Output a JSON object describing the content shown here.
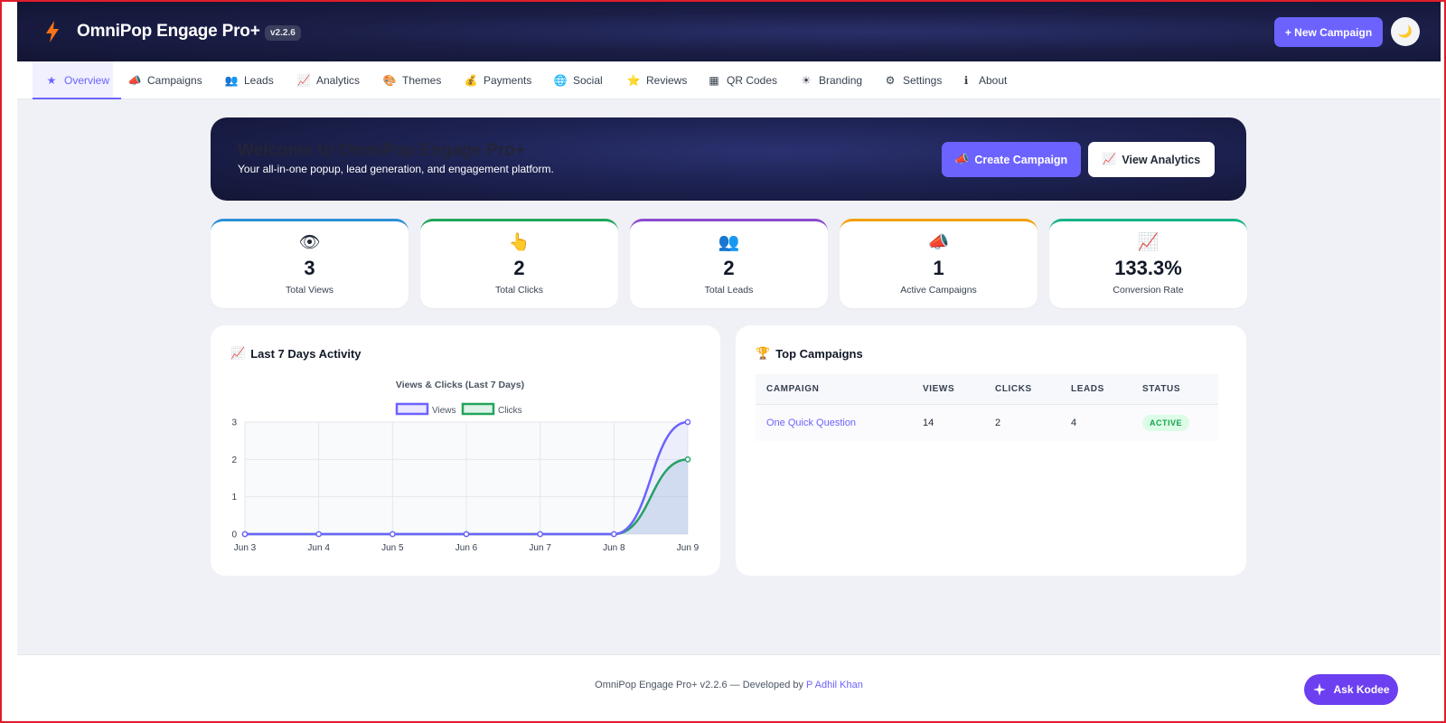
{
  "header": {
    "brand": "OmniPop Engage Pro+",
    "version": "v2.2.6",
    "new_campaign_label": "+ New Campaign",
    "theme_toggle_icon": "🌙"
  },
  "tabs": [
    {
      "icon": "★",
      "label": "Overview",
      "active": true
    },
    {
      "icon": "📣",
      "label": "Campaigns"
    },
    {
      "icon": "👥",
      "label": "Leads"
    },
    {
      "icon": "📈",
      "label": "Analytics"
    },
    {
      "icon": "🎨",
      "label": "Themes"
    },
    {
      "icon": "💰",
      "label": "Payments"
    },
    {
      "icon": "🌐",
      "label": "Social"
    },
    {
      "icon": "⭐",
      "label": "Reviews"
    },
    {
      "icon": "▦",
      "label": "QR Codes"
    },
    {
      "icon": "☀",
      "label": "Branding"
    },
    {
      "icon": "⚙",
      "label": "Settings"
    },
    {
      "icon": "ℹ",
      "label": "About"
    }
  ],
  "hero": {
    "title": "Welcome to OmniPop Engage Pro+",
    "subtitle": "Your all-in-one popup, lead generation, and engagement platform.",
    "create_label": "Create Campaign",
    "create_icon": "📣",
    "view_label": "View Analytics",
    "view_icon": "📈"
  },
  "stats": [
    {
      "icon": "👁",
      "value": "3",
      "label": "Total Views",
      "color": "#2b8fd6"
    },
    {
      "icon": "👆",
      "value": "2",
      "label": "Total Clicks",
      "color": "#22a55b"
    },
    {
      "icon": "👥",
      "value": "2",
      "label": "Total Leads",
      "color": "#8a4bd1"
    },
    {
      "icon": "📣",
      "value": "1",
      "label": "Active Campaigns",
      "color": "#f59e0b"
    },
    {
      "icon": "📈",
      "value": "133.3%",
      "label": "Conversion Rate",
      "color": "#16b386"
    }
  ],
  "activity_panel": {
    "title": "Last 7 Days Activity",
    "icon": "📈"
  },
  "chart_data": {
    "type": "line",
    "title": "Views & Clicks (Last 7 Days)",
    "categories": [
      "Jun 3",
      "Jun 4",
      "Jun 5",
      "Jun 6",
      "Jun 7",
      "Jun 8",
      "Jun 9"
    ],
    "series": [
      {
        "name": "Views",
        "values": [
          0,
          0,
          0,
          0,
          0,
          0,
          3
        ],
        "color": "#6c63ff"
      },
      {
        "name": "Clicks",
        "values": [
          0,
          0,
          0,
          0,
          0,
          0,
          2
        ],
        "color": "#22a55b"
      }
    ],
    "yticks": [
      "0",
      "1",
      "2",
      "3"
    ],
    "ylim": [
      0,
      3
    ],
    "grid": true,
    "legend": "top-center"
  },
  "top_campaigns": {
    "title": "Top Campaigns",
    "icon": "🏆",
    "columns": [
      "CAMPAIGN",
      "VIEWS",
      "CLICKS",
      "LEADS",
      "STATUS"
    ],
    "rows": [
      {
        "campaign": "One Quick Question",
        "views": "14",
        "clicks": "2",
        "leads": "4",
        "status": "ACTIVE"
      }
    ]
  },
  "footer": {
    "text": "OmniPop Engage Pro+ v2.2.6 — Developed by ",
    "developer": "P Adhil Khan",
    "ask_label": "Ask Kodee"
  }
}
